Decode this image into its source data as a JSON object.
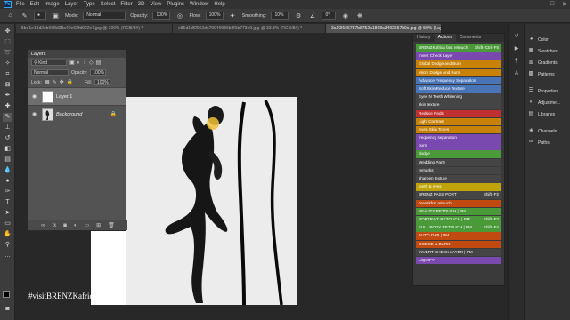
{
  "app": {
    "logo_text": "Ps",
    "menu": [
      "File",
      "Edit",
      "Image",
      "Layer",
      "Type",
      "Select",
      "Filter",
      "3D",
      "View",
      "Plugins",
      "Window",
      "Help"
    ],
    "window_controls": [
      "—",
      "□",
      "✕"
    ]
  },
  "options_bar": {
    "mode_label": "Mode:",
    "mode_value": "Normal",
    "opacity_label": "Opacity:",
    "opacity_value": "100%",
    "flow_label": "Flow:",
    "flow_value": "100%",
    "smoothing_label": "Smoothing:",
    "smoothing_value": "10%",
    "angle_value": "0°"
  },
  "tabs": [
    {
      "label": "5bd1e13d2eb668d28a49e62fd992c7.jpg @ 100% (RGB/8#) *",
      "active": false
    },
    {
      "label": "e85d1df2952dc79040986b8f1b773e9.jpg @ 33.3% (RGB/8#) *",
      "active": false
    },
    {
      "label": "3a10f165787b8752a1898a3492557b9c.jpg @ 50% (Layer 1, RGB/8#) *",
      "active": true
    }
  ],
  "layers_panel": {
    "title": "Layers",
    "kind_label": "Kind",
    "blend_mode": "Normal",
    "opacity_label": "Opacity:",
    "opacity_value": "100%",
    "lock_label": "Lock:",
    "fill_label": "Fill:",
    "fill_value": "100%",
    "layers": [
      {
        "name": "Layer 1",
        "selected": true
      },
      {
        "name": "Background",
        "selected": false
      }
    ],
    "footer_icons": [
      "link-icon",
      "fx-icon",
      "mask-icon",
      "adjustment-icon",
      "group-icon",
      "new-layer-icon",
      "trash-icon"
    ]
  },
  "actions_panel": {
    "tab_history": "History",
    "tab_actions": "Actions",
    "tab_comments": "Comments",
    "actions": [
      {
        "label": "BRENZKafrica fast retouch",
        "shortcut": "Shift+Ctrl+F5",
        "color": "#4a9a3a"
      },
      {
        "label": "Invert Check Layer",
        "shortcut": "",
        "color": "#7a49b0"
      },
      {
        "label": "Global Dodge and Burn",
        "shortcut": "",
        "color": "#c8820a"
      },
      {
        "label": "Micro Dodge And Burn",
        "shortcut": "",
        "color": "#c8820a"
      },
      {
        "label": "Advance Frequency Separation",
        "shortcut": "",
        "color": "#4a74b8"
      },
      {
        "label": "Soft Skin/Reduce Texture",
        "shortcut": "",
        "color": "#4a74b8"
      },
      {
        "label": "Eyes N Teeth Whitening",
        "shortcut": "",
        "color": "#454545"
      },
      {
        "label": "skin texture",
        "shortcut": "",
        "color": "#454545"
      },
      {
        "label": "Reduce Reds",
        "shortcut": "",
        "color": "#c03030"
      },
      {
        "label": "Light Contrast",
        "shortcut": "",
        "color": "#c8820a"
      },
      {
        "label": "Even Skin Tones",
        "shortcut": "",
        "color": "#c8820a"
      },
      {
        "label": "frequency separation",
        "shortcut": "",
        "color": "#7a49b0"
      },
      {
        "label": "burn",
        "shortcut": "",
        "color": "#7a49b0"
      },
      {
        "label": "dodge",
        "shortcut": "",
        "color": "#4a9a3a"
      },
      {
        "label": "Wedding Party",
        "shortcut": "",
        "color": "#454545"
      },
      {
        "label": "remarks",
        "shortcut": "",
        "color": "#454545"
      },
      {
        "label": "sharpen texture",
        "shortcut": "",
        "color": "#454545"
      },
      {
        "label": "teeth & eyes",
        "shortcut": "",
        "color": "#bfa40a"
      },
      {
        "label": "BRENZ PASS PORT",
        "shortcut": "Shift+F2",
        "color": "#454545"
      },
      {
        "label": "brenzkfrst retouch",
        "shortcut": "",
        "color": "#c04a10"
      },
      {
        "label": "BEAUTY RETOUCH | PM",
        "shortcut": "",
        "color": "#4a9a3a"
      },
      {
        "label": "PORTRAIT RETOUCH | PM",
        "shortcut": "Shift+F3",
        "color": "#4a9a3a"
      },
      {
        "label": "FULL BODY RETOUCH | PM",
        "shortcut": "Shift+F4",
        "color": "#4a9a3a"
      },
      {
        "label": "AUTO D&B | PM",
        "shortcut": "",
        "color": "#c04a10"
      },
      {
        "label": "DODGE & BURN",
        "shortcut": "",
        "color": "#c04a10"
      },
      {
        "label": "INVERT CHECK LAYER | PM",
        "shortcut": "",
        "color": "#454545"
      },
      {
        "label": "LIQUIFY",
        "shortcut": "",
        "color": "#7a49b0"
      }
    ]
  },
  "dock": {
    "items": [
      {
        "label": "Color",
        "icon": "color-icon"
      },
      {
        "label": "Swatches",
        "icon": "swatches-icon"
      },
      {
        "label": "Gradients",
        "icon": "gradients-icon"
      },
      {
        "label": "Patterns",
        "icon": "patterns-icon"
      },
      {
        "label": "Properties",
        "icon": "properties-icon"
      },
      {
        "label": "Adjustme...",
        "icon": "adjustments-icon"
      },
      {
        "label": "Libraries",
        "icon": "libraries-icon"
      },
      {
        "label": "Channels",
        "icon": "channels-icon"
      },
      {
        "label": "Paths",
        "icon": "paths-icon"
      }
    ]
  },
  "canvas": {
    "watermark": "#visitBRENZKafrica"
  }
}
